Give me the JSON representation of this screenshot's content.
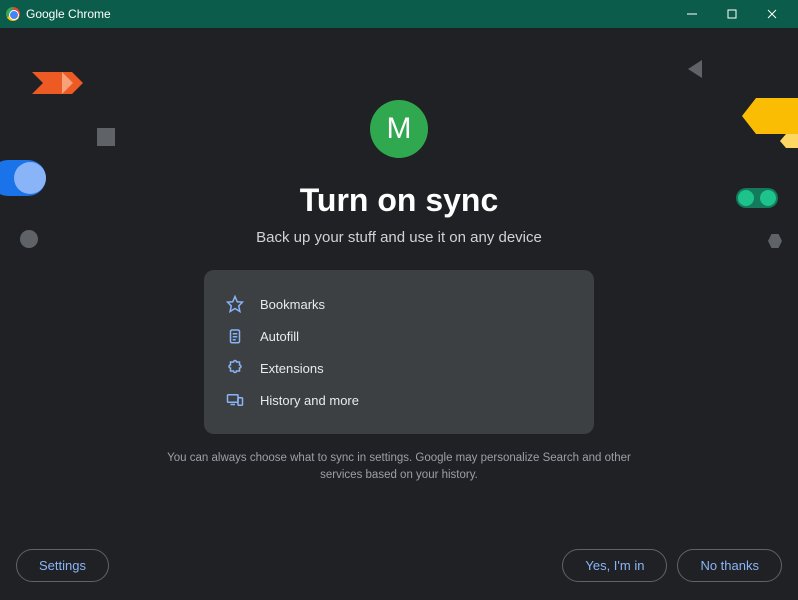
{
  "window": {
    "title": "Google Chrome"
  },
  "avatar": {
    "letter": "M",
    "bg_color": "#2fa84f"
  },
  "main": {
    "heading": "Turn on sync",
    "subheading": "Back up your stuff and use it on any device",
    "disclaimer": "You can always choose what to sync in settings. Google may personalize Search and other services based on your history."
  },
  "sync_items": [
    {
      "icon": "star-icon",
      "label": "Bookmarks"
    },
    {
      "icon": "clipboard-icon",
      "label": "Autofill"
    },
    {
      "icon": "puzzle-icon",
      "label": "Extensions"
    },
    {
      "icon": "devices-icon",
      "label": "History and more"
    }
  ],
  "footer": {
    "settings_label": "Settings",
    "yes_label": "Yes, I'm in",
    "no_label": "No thanks"
  }
}
